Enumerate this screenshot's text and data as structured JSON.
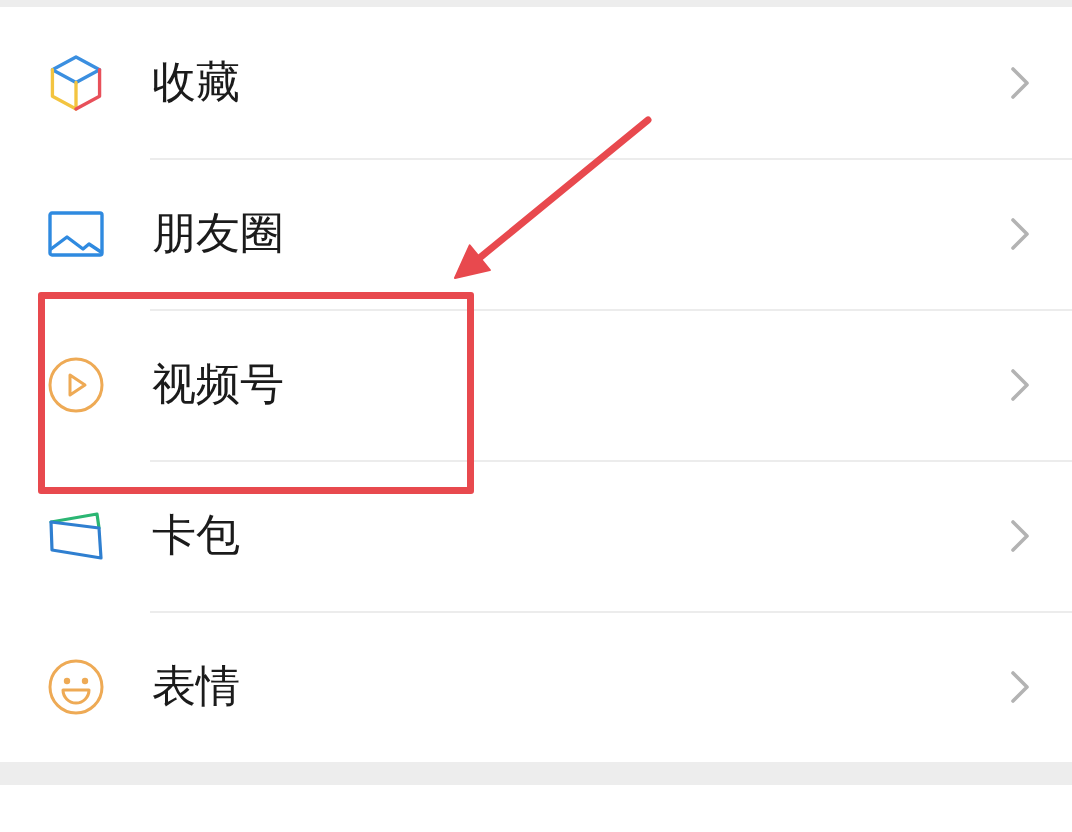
{
  "items": [
    {
      "label": "收藏",
      "kind": "cube",
      "highlighted": false
    },
    {
      "label": "朋友圈",
      "kind": "image",
      "highlighted": false
    },
    {
      "label": "视频号",
      "kind": "play",
      "highlighted": true
    },
    {
      "label": "卡包",
      "kind": "wallet",
      "highlighted": false
    },
    {
      "label": "表情",
      "kind": "smile",
      "highlighted": false
    }
  ]
}
